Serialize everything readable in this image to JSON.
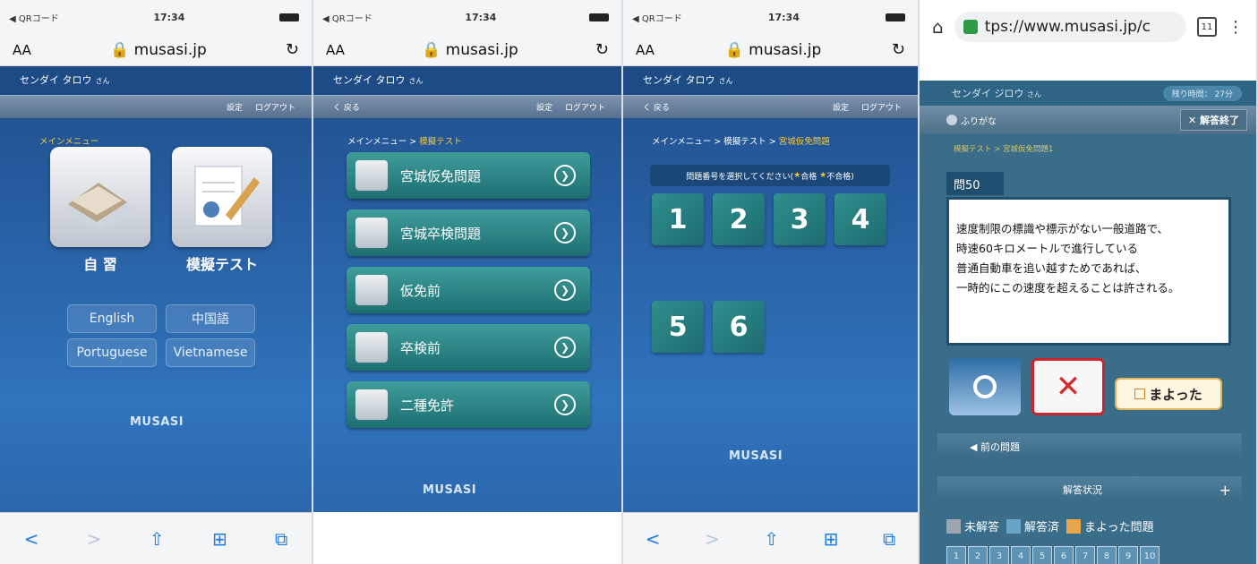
{
  "status": {
    "carrier": "◀ QRコード",
    "time": "17:34"
  },
  "safari": {
    "aa": "AA",
    "url": "musasi.jp",
    "reload": "↻"
  },
  "user": {
    "name": "センダイ タロウ",
    "suffix": "さん"
  },
  "nav": {
    "back": "く 戻る",
    "settings": "設定",
    "logout": "ログアウト"
  },
  "panel1": {
    "crumb": "メインメニュー",
    "study_label": "自 習",
    "mock_label": "模擬テスト",
    "languages": [
      "English",
      "中国語",
      "Portuguese",
      "Vietnamese"
    ]
  },
  "logo": "MUSASI",
  "panel2": {
    "crumb_root": "メインメニュー > ",
    "crumb_current": "模擬テスト",
    "items": [
      "宮城仮免問題",
      "宮城卒検問題",
      "仮免前",
      "卒検前",
      "二種免許"
    ]
  },
  "panel3": {
    "crumb_root": "メインメニュー > 模擬テスト > ",
    "crumb_current": "宮城仮免問題",
    "select_text": "問題番号を選択してください(",
    "pass": "合格",
    "fail": "不合格)",
    "numbers": [
      "1",
      "2",
      "3",
      "4",
      "5",
      "6"
    ]
  },
  "toolbar": {
    "back": "<",
    "forward": ">",
    "share": "⇧",
    "book": "⊞",
    "tabs": "⧉"
  },
  "panel4": {
    "url": "tps://www.musasi.jp/c",
    "tab_count": "11",
    "user": "センダイ ジロウ",
    "suffix": "さん",
    "remaining": "残り時間： 27分",
    "furigana": "ふりがな",
    "end": "✕ 解答終了",
    "crumb": "模擬テスト > 宮城仮免問題1",
    "question_no": "問50",
    "question_lines": [
      "速度制限の標識や標示がない一般道路で、",
      "時速60キロメートルで進行している",
      "普通自動車を追い越すためであれば、",
      "一時的にこの速度を超えることは許される。"
    ],
    "answer_x": "✕",
    "unsure": "まよった",
    "prev": "◀ 前の問題",
    "status_header": "解答状況",
    "plus": "+",
    "legend": [
      "未解答",
      "解答済",
      "まよった問題"
    ],
    "legend_colors": [
      "#9aa7b1",
      "#6aa3c8",
      "#e8a64c"
    ],
    "grid": [
      "1",
      "2",
      "3",
      "4",
      "5",
      "6",
      "7",
      "8",
      "9",
      "10"
    ]
  }
}
